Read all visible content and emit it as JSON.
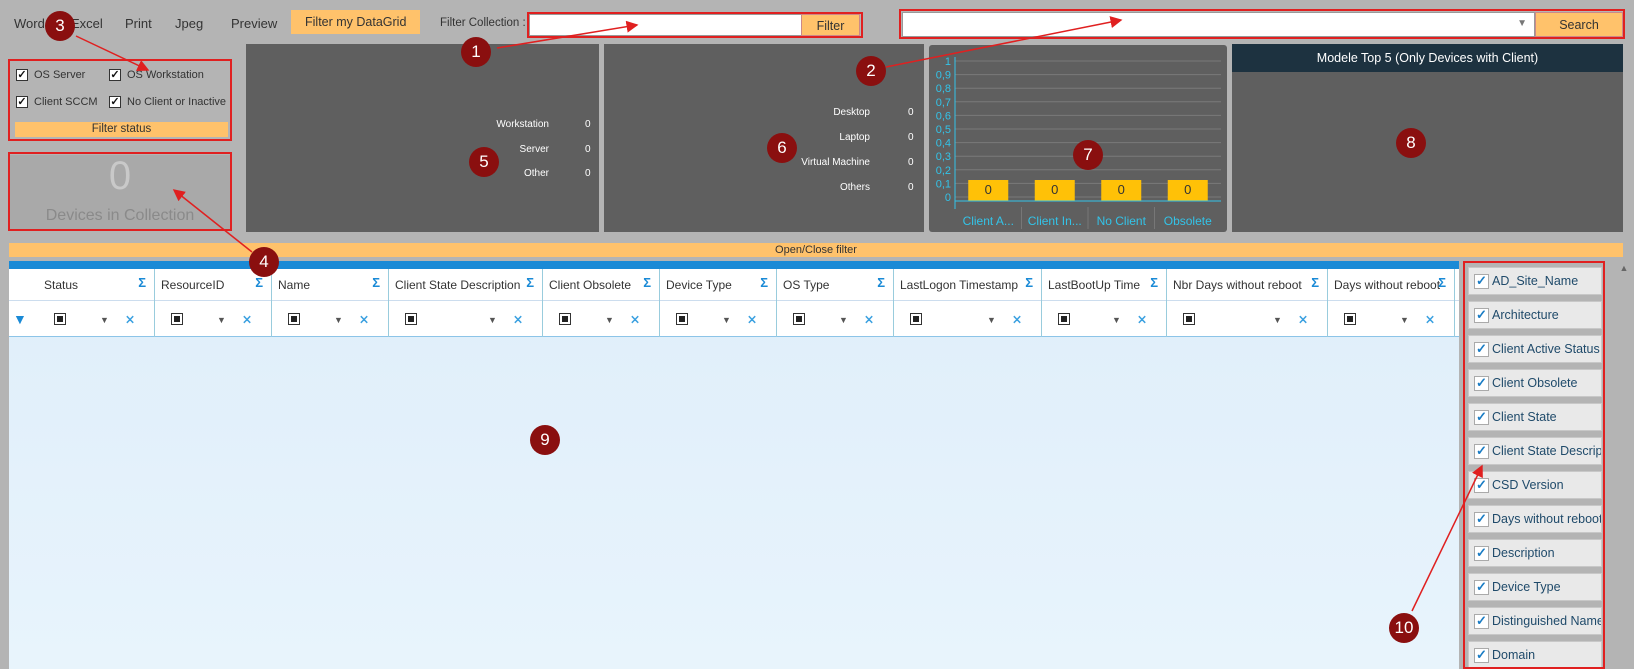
{
  "toolbar": {
    "word": "Word",
    "excel": "Excel",
    "print": "Print",
    "jpeg": "Jpeg",
    "preview": "Preview",
    "filter_datagrid": "Filter my DataGrid",
    "filter_collection_label": "Filter Collection :",
    "filter_collection_value": "",
    "filter_button": "Filter",
    "search_value": "",
    "search_button": "Search"
  },
  "status_filters": {
    "os_server": "OS Server",
    "os_workstation": "OS Workstation",
    "client_sccm": "Client SCCM",
    "no_client": "No Client or Inactive",
    "filter_status": "Filter status"
  },
  "devices": {
    "count": "0",
    "label": "Devices in Collection"
  },
  "os_panel": {
    "rows": [
      {
        "label": "Workstation",
        "value": "0"
      },
      {
        "label": "Server",
        "value": "0"
      },
      {
        "label": "Other",
        "value": "0"
      }
    ]
  },
  "type_panel": {
    "rows": [
      {
        "label": "Desktop",
        "value": "0"
      },
      {
        "label": "Laptop",
        "value": "0"
      },
      {
        "label": "Virtual Machine",
        "value": "0"
      },
      {
        "label": "Others",
        "value": "0"
      }
    ]
  },
  "chart_data": {
    "type": "bar",
    "categories": [
      "Client A...",
      "Client In...",
      "No Client",
      "Obsolete"
    ],
    "values": [
      0,
      0,
      0,
      0
    ],
    "data_labels": [
      "0",
      "0",
      "0",
      "0"
    ],
    "yticks": [
      "1",
      "0,9",
      "0,8",
      "0,7",
      "0,6",
      "0,5",
      "0,4",
      "0,3",
      "0,2",
      "0,1",
      "0"
    ],
    "ylim": [
      0,
      1
    ],
    "grid": true,
    "bar_color": "#ffc107",
    "text_color": "#33c3e8"
  },
  "modele": {
    "title": "Modele Top 5 (Only Devices with Client)"
  },
  "open_close": "Open/Close filter",
  "grid": {
    "columns": [
      "Status",
      "ResourceID",
      "Name",
      "Client State Description",
      "Client Obsolete",
      "Device Type",
      "OS Type",
      "LastLogon Timestamp",
      "LastBootUp Time",
      "Nbr Days without reboot",
      "Days without reboot"
    ]
  },
  "column_chooser": [
    "AD_Site_Name",
    "Architecture",
    "Client Active Status",
    "Client Obsolete",
    "Client State",
    "Client State Descript",
    "CSD Version",
    "Days without reboot",
    "Description",
    "Device Type",
    "Distinguished Name",
    "Domain"
  ],
  "markers": [
    "1",
    "2",
    "3",
    "4",
    "5",
    "6",
    "7",
    "8",
    "9",
    "10"
  ],
  "colors": {
    "accent_orange": "#ffc26b",
    "highlight_red": "#e02020",
    "marker": "#8a0f0f",
    "grid_blue": "#1a8ad6",
    "header_dark": "#1d3240"
  }
}
